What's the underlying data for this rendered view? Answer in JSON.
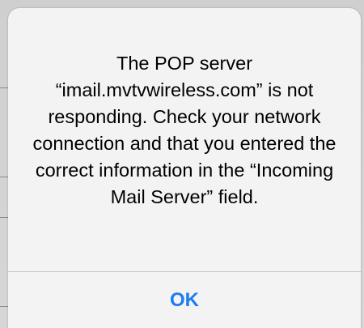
{
  "alert": {
    "message": "The POP server “imail.mvtvwireless.com” is not responding. Check your network connection and that you entered the correct information in the “Incoming Mail Server” field.",
    "ok_label": "OK"
  },
  "colors": {
    "accent": "#1a7cf2",
    "alert_background": "#f3f3f3",
    "backdrop": "#d2d2d2",
    "divider": "#c4c4c4"
  }
}
